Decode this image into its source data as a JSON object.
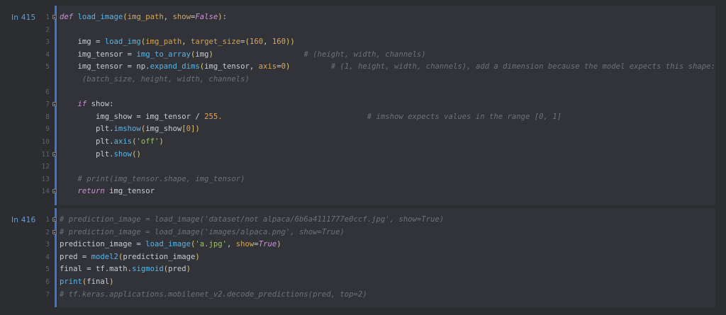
{
  "cells": [
    {
      "prompt": "In 415",
      "lines": [
        {
          "n": "1",
          "parts": [
            {
              "t": "kw",
              "v": "def "
            },
            {
              "t": "fn",
              "v": "load_image"
            },
            {
              "t": "br",
              "v": "("
            },
            {
              "t": "pa",
              "v": "img_path"
            },
            {
              "t": "default",
              "v": ", "
            },
            {
              "t": "pa",
              "v": "show"
            },
            {
              "t": "default",
              "v": "="
            },
            {
              "t": "gl",
              "v": "False"
            },
            {
              "t": "br",
              "v": ")"
            },
            {
              "t": "default",
              "v": ":"
            }
          ]
        },
        {
          "n": "2",
          "parts": []
        },
        {
          "n": "3",
          "parts": [
            {
              "t": "default",
              "v": "    img = "
            },
            {
              "t": "fn",
              "v": "load_img"
            },
            {
              "t": "br",
              "v": "("
            },
            {
              "t": "pa",
              "v": "img_path"
            },
            {
              "t": "default",
              "v": ", "
            },
            {
              "t": "pa",
              "v": "target_size"
            },
            {
              "t": "default",
              "v": "="
            },
            {
              "t": "br",
              "v": "("
            },
            {
              "t": "nu",
              "v": "160"
            },
            {
              "t": "default",
              "v": ", "
            },
            {
              "t": "nu",
              "v": "160"
            },
            {
              "t": "br",
              "v": "))"
            }
          ]
        },
        {
          "n": "4",
          "parts": [
            {
              "t": "default",
              "v": "    img_tensor = "
            },
            {
              "t": "fn",
              "v": "img_to_array"
            },
            {
              "t": "br",
              "v": "("
            },
            {
              "t": "default",
              "v": "img"
            },
            {
              "t": "br",
              "v": ")"
            },
            {
              "t": "default",
              "v": "                    "
            },
            {
              "t": "cm",
              "v": "# (height, width, channels)"
            }
          ]
        },
        {
          "n": "5",
          "parts": [
            {
              "t": "default",
              "v": "    img_tensor = np."
            },
            {
              "t": "fn",
              "v": "expand_dims"
            },
            {
              "t": "br",
              "v": "("
            },
            {
              "t": "default",
              "v": "img_tensor, "
            },
            {
              "t": "pa",
              "v": "axis"
            },
            {
              "t": "default",
              "v": "="
            },
            {
              "t": "nu",
              "v": "0"
            },
            {
              "t": "br",
              "v": ")"
            },
            {
              "t": "default",
              "v": "         "
            },
            {
              "t": "cm",
              "v": "# (1, height, width, channels), add a dimension because the model expects this shape:"
            }
          ]
        },
        {
          "n": "",
          "parts": [
            {
              "t": "default",
              "v": "     "
            },
            {
              "t": "cm",
              "v": "(batch_size, height, width, channels)"
            }
          ]
        },
        {
          "n": "6",
          "parts": []
        },
        {
          "n": "7",
          "parts": [
            {
              "t": "default",
              "v": "    "
            },
            {
              "t": "kw",
              "v": "if "
            },
            {
              "t": "default",
              "v": "show:"
            }
          ]
        },
        {
          "n": "8",
          "parts": [
            {
              "t": "default",
              "v": "        img_show = img_tensor / "
            },
            {
              "t": "nu",
              "v": "255."
            },
            {
              "t": "default",
              "v": "                                "
            },
            {
              "t": "cm",
              "v": "# imshow expects values in the range [0, 1]"
            }
          ]
        },
        {
          "n": "9",
          "parts": [
            {
              "t": "default",
              "v": "        plt."
            },
            {
              "t": "fn",
              "v": "imshow"
            },
            {
              "t": "br",
              "v": "("
            },
            {
              "t": "default",
              "v": "img_show"
            },
            {
              "t": "br",
              "v": "["
            },
            {
              "t": "nu",
              "v": "0"
            },
            {
              "t": "br",
              "v": "])"
            }
          ]
        },
        {
          "n": "10",
          "parts": [
            {
              "t": "default",
              "v": "        plt."
            },
            {
              "t": "fn",
              "v": "axis"
            },
            {
              "t": "br",
              "v": "("
            },
            {
              "t": "st",
              "v": "'off'"
            },
            {
              "t": "br",
              "v": ")"
            }
          ]
        },
        {
          "n": "11",
          "parts": [
            {
              "t": "default",
              "v": "        plt."
            },
            {
              "t": "fn",
              "v": "show"
            },
            {
              "t": "br",
              "v": "()"
            }
          ]
        },
        {
          "n": "12",
          "parts": []
        },
        {
          "n": "13",
          "parts": [
            {
              "t": "default",
              "v": "    "
            },
            {
              "t": "cm",
              "v": "# print(img_tensor.shape, img_tensor)"
            }
          ]
        },
        {
          "n": "14",
          "parts": [
            {
              "t": "default",
              "v": "    "
            },
            {
              "t": "kw",
              "v": "return "
            },
            {
              "t": "default",
              "v": "img_tensor"
            }
          ]
        }
      ]
    },
    {
      "prompt": "In 416",
      "lines": [
        {
          "n": "1",
          "parts": [
            {
              "t": "cm",
              "v": "# prediction_image = load_image('dataset/not alpaca/6b6a4111777e0ccf.jpg', show=True)"
            }
          ]
        },
        {
          "n": "2",
          "parts": [
            {
              "t": "cm",
              "v": "# prediction_image = load_image('images/alpaca.png', show=True)"
            }
          ]
        },
        {
          "n": "3",
          "parts": [
            {
              "t": "default",
              "v": "prediction_image = "
            },
            {
              "t": "fn",
              "v": "load_image"
            },
            {
              "t": "br",
              "v": "("
            },
            {
              "t": "st",
              "v": "'a.jpg'"
            },
            {
              "t": "default",
              "v": ", "
            },
            {
              "t": "pa",
              "v": "show"
            },
            {
              "t": "default",
              "v": "="
            },
            {
              "t": "gl",
              "v": "True"
            },
            {
              "t": "br",
              "v": ")"
            }
          ]
        },
        {
          "n": "4",
          "parts": [
            {
              "t": "default",
              "v": "pred = "
            },
            {
              "t": "fn",
              "v": "model2"
            },
            {
              "t": "br",
              "v": "("
            },
            {
              "t": "default",
              "v": "prediction_image"
            },
            {
              "t": "br",
              "v": ")"
            }
          ]
        },
        {
          "n": "5",
          "parts": [
            {
              "t": "default",
              "v": "final = tf.math."
            },
            {
              "t": "fn",
              "v": "sigmoid"
            },
            {
              "t": "br",
              "v": "("
            },
            {
              "t": "default",
              "v": "pred"
            },
            {
              "t": "br",
              "v": ")"
            }
          ]
        },
        {
          "n": "6",
          "parts": [
            {
              "t": "fn",
              "v": "print"
            },
            {
              "t": "br",
              "v": "("
            },
            {
              "t": "default",
              "v": "final"
            },
            {
              "t": "br",
              "v": ")"
            }
          ]
        },
        {
          "n": "7",
          "parts": [
            {
              "t": "cm",
              "v": "# tf.keras.applications.mobilenet_v2.decode_predictions(pred, top=2)"
            }
          ]
        }
      ]
    }
  ]
}
